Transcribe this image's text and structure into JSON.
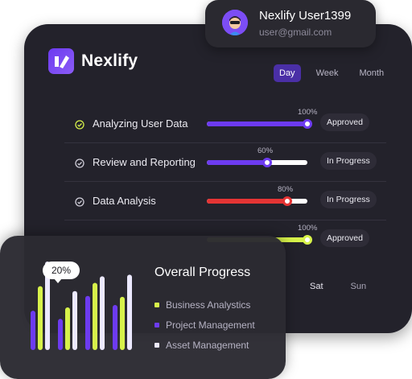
{
  "brand": {
    "name": "Nexlify"
  },
  "user": {
    "name": "Nexlify User1399",
    "email": "user@gmail.com"
  },
  "tabs": [
    {
      "label": "Day",
      "active": true
    },
    {
      "label": "Week",
      "active": false
    },
    {
      "label": "Month",
      "active": false
    }
  ],
  "tasks": [
    {
      "label": "Analyzing User Data",
      "percent": 100,
      "percent_label": "100%",
      "bar_color": "#6d3bf0",
      "status": "Approved"
    },
    {
      "label": "Review and Reporting",
      "percent": 60,
      "percent_label": "60%",
      "bar_color": "#6d3bf0",
      "status": "In Progress"
    },
    {
      "label": "Data Analysis",
      "percent": 80,
      "percent_label": "80%",
      "bar_color": "#e53434",
      "status": "In Progress"
    },
    {
      "label": "",
      "percent": 100,
      "percent_label": "100%",
      "bar_color": "#d7f24a",
      "status": "Approved"
    }
  ],
  "days": [
    {
      "label": "Sat",
      "dim": false
    },
    {
      "label": "Sun",
      "dim": true
    }
  ],
  "overall": {
    "title": "Overall Progress",
    "tooltip": "20%",
    "legend": [
      {
        "label": "Business Analystics",
        "color": "#d7f24a"
      },
      {
        "label": "Project Management",
        "color": "#6d3bf0"
      },
      {
        "label": "Asset Management",
        "color": "#ece9ff"
      }
    ]
  },
  "chart_data": {
    "type": "bar",
    "series": [
      {
        "values": [
          48,
          78,
          108
        ]
      },
      {
        "values": [
          38,
          52,
          72
        ]
      },
      {
        "values": [
          66,
          82,
          90
        ]
      },
      {
        "values": [
          55,
          65,
          92
        ]
      }
    ],
    "colors": [
      "#6d3bf0",
      "#d7f24a",
      "#ece9ff"
    ]
  }
}
